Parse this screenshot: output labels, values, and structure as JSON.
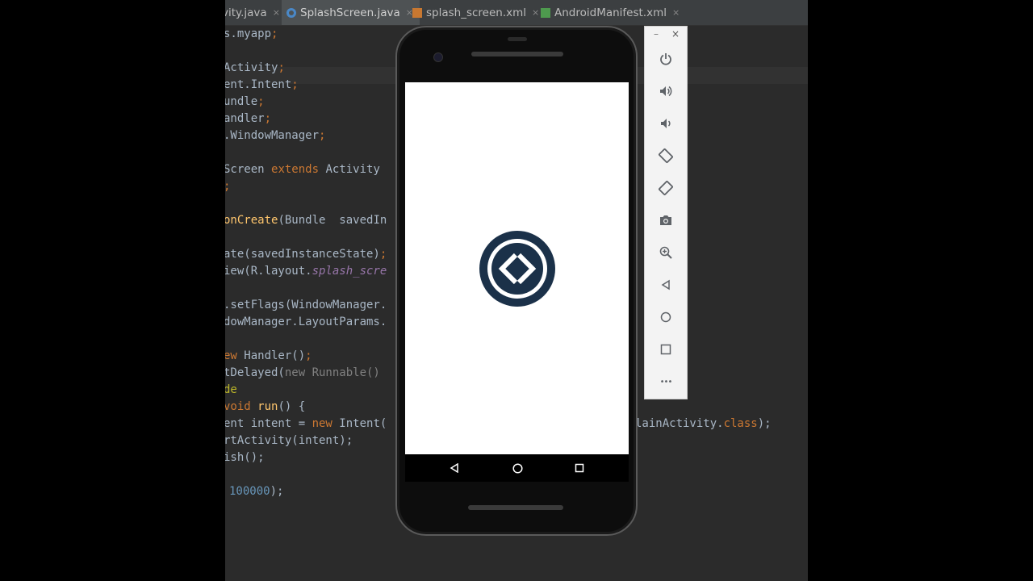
{
  "tabs": [
    {
      "label": "vity.java",
      "icon": "java-file-icon"
    },
    {
      "label": "SplashScreen.java",
      "icon": "java-class-icon",
      "active": true
    },
    {
      "label": "splash_screen.xml",
      "icon": "xml-file-icon"
    },
    {
      "label": "AndroidManifest.xml",
      "icon": "manifest-file-icon"
    }
  ],
  "tab_close_glyph": "×",
  "code": {
    "l1": "s.myapp",
    "l3": "Activity",
    "l4": "ent.Intent",
    "l5": "undle",
    "l6": "andler",
    "l7": ".WindowManager",
    "l9a": "Screen ",
    "l9b": "extends",
    "l9c": " Activity",
    "l10": ";",
    "l12a": "onCreate",
    "l12b": "(Bundle  savedIn",
    "l14": "ate(savedInstanceState)",
    "l15a": "iew(R.layout.",
    "l15b": "splash_scre",
    "l17": ".setFlags(WindowManager.",
    "l18": "dowManager.LayoutParams.",
    "l20a": "ew",
    "l20b": " Handler()",
    "l21a": "tDelayed(",
    "l21b": "new Runnable()",
    "l22": "de",
    "l23a": "void",
    "l23b": "run",
    "l23c": "() {",
    "l24a": "ent intent = ",
    "l24b": "new",
    "l24c": " Intent(",
    "l24d": "lainActivity.",
    "l24e": "class",
    "l24f": ");",
    "l25": "rtActivity(intent);",
    "l26": "ish();",
    "l28a": "100000",
    "l28b": ");",
    "semi": ";"
  },
  "phone": {
    "screen_bg": "#ffffff",
    "logo_color": "#1b3149",
    "nav": [
      "back-icon",
      "home-icon",
      "recents-icon"
    ]
  },
  "emulator_toolbar": {
    "minimize": "–",
    "close": "×",
    "buttons": [
      "power-icon",
      "volume-up-icon",
      "volume-down-icon",
      "rotate-left-icon",
      "rotate-right-icon",
      "camera-icon",
      "zoom-icon",
      "back-icon",
      "home-icon",
      "overview-icon",
      "more-icon"
    ],
    "more": "•••"
  }
}
